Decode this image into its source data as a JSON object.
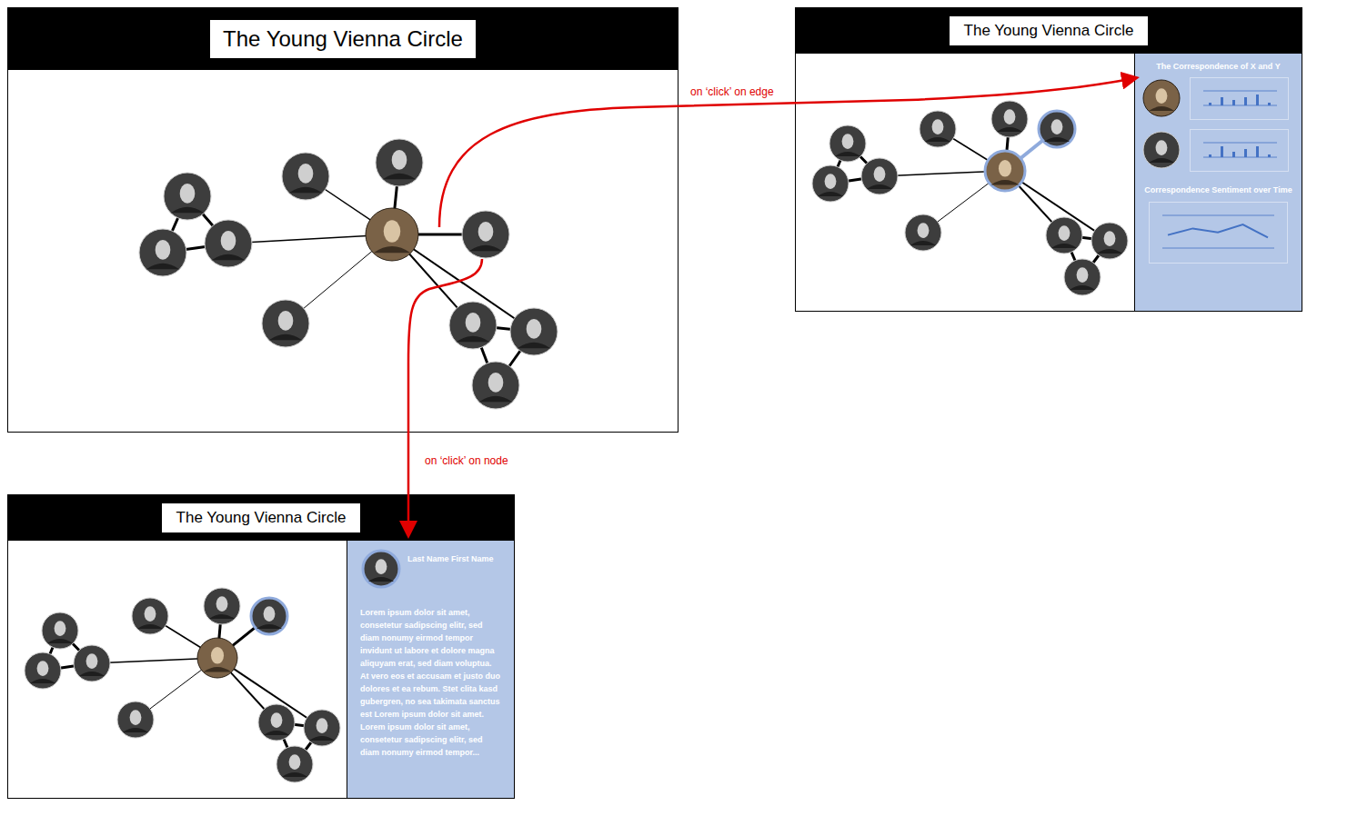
{
  "overview": {
    "title": "The Young Vienna Circle",
    "nodes": [
      {
        "kind": "center",
        "selected": false
      },
      {
        "kind": "person",
        "selected": false
      },
      {
        "kind": "person",
        "selected": false
      },
      {
        "kind": "person",
        "selected": false
      },
      {
        "kind": "person",
        "selected": false
      },
      {
        "kind": "person",
        "selected": false
      },
      {
        "kind": "person",
        "selected": false
      },
      {
        "kind": "person",
        "selected": false
      },
      {
        "kind": "person",
        "selected": false
      },
      {
        "kind": "person",
        "selected": false
      },
      {
        "kind": "person",
        "selected": false
      }
    ],
    "edges": [
      {
        "from": 1,
        "to": 2,
        "weight": 3,
        "selected": false
      },
      {
        "from": 1,
        "to": 3,
        "weight": 3,
        "selected": false
      },
      {
        "from": 2,
        "to": 3,
        "weight": 3,
        "selected": false
      },
      {
        "from": 3,
        "to": 0,
        "weight": 1.5,
        "selected": false
      },
      {
        "from": 4,
        "to": 0,
        "weight": 1.5,
        "selected": false
      },
      {
        "from": 5,
        "to": 0,
        "weight": 3,
        "selected": false
      },
      {
        "from": 6,
        "to": 0,
        "weight": 3,
        "selected": false
      },
      {
        "from": 7,
        "to": 0,
        "weight": 1,
        "selected": false
      },
      {
        "from": 8,
        "to": 0,
        "weight": 2,
        "selected": false
      },
      {
        "from": 9,
        "to": 0,
        "weight": 2,
        "selected": false
      },
      {
        "from": 8,
        "to": 9,
        "weight": 3,
        "selected": false
      },
      {
        "from": 8,
        "to": 10,
        "weight": 3,
        "selected": false
      },
      {
        "from": 9,
        "to": 10,
        "weight": 3,
        "selected": false
      }
    ]
  },
  "edge_view": {
    "title": "The Young Vienna Circle",
    "nodes": [
      {
        "kind": "center",
        "selected": true
      },
      {
        "kind": "person",
        "selected": false
      },
      {
        "kind": "person",
        "selected": false
      },
      {
        "kind": "person",
        "selected": false
      },
      {
        "kind": "person",
        "selected": false
      },
      {
        "kind": "person",
        "selected": false
      },
      {
        "kind": "person",
        "selected": true
      },
      {
        "kind": "person",
        "selected": false
      },
      {
        "kind": "person",
        "selected": false
      },
      {
        "kind": "person",
        "selected": false
      },
      {
        "kind": "person",
        "selected": false
      }
    ],
    "edges": [
      {
        "from": 1,
        "to": 2,
        "weight": 3,
        "selected": false
      },
      {
        "from": 1,
        "to": 3,
        "weight": 3,
        "selected": false
      },
      {
        "from": 2,
        "to": 3,
        "weight": 3,
        "selected": false
      },
      {
        "from": 3,
        "to": 0,
        "weight": 1.5,
        "selected": false
      },
      {
        "from": 4,
        "to": 0,
        "weight": 1.5,
        "selected": false
      },
      {
        "from": 5,
        "to": 0,
        "weight": 3,
        "selected": false
      },
      {
        "from": 6,
        "to": 0,
        "weight": 3,
        "selected": true
      },
      {
        "from": 7,
        "to": 0,
        "weight": 1,
        "selected": false
      },
      {
        "from": 8,
        "to": 0,
        "weight": 2,
        "selected": false
      },
      {
        "from": 9,
        "to": 0,
        "weight": 2,
        "selected": false
      },
      {
        "from": 8,
        "to": 9,
        "weight": 3,
        "selected": false
      },
      {
        "from": 8,
        "to": 10,
        "weight": 3,
        "selected": false
      },
      {
        "from": 9,
        "to": 10,
        "weight": 3,
        "selected": false
      }
    ],
    "panel": {
      "title": "The Correspondence of X and Y",
      "letters": [
        {
          "kind": "center",
          "values": [
            1,
            3,
            2,
            3,
            4,
            1
          ]
        },
        {
          "kind": "person",
          "values": [
            1,
            4,
            2,
            3,
            4,
            1
          ]
        }
      ],
      "chart_title": "Correspondence Sentiment over Time",
      "sentiment": [
        2,
        3,
        2.4,
        3.6,
        1.6
      ]
    }
  },
  "node_view": {
    "title": "The Young Vienna Circle",
    "nodes": [
      {
        "kind": "center",
        "selected": false
      },
      {
        "kind": "person",
        "selected": false
      },
      {
        "kind": "person",
        "selected": false
      },
      {
        "kind": "person",
        "selected": false
      },
      {
        "kind": "person",
        "selected": false
      },
      {
        "kind": "person",
        "selected": false
      },
      {
        "kind": "person",
        "selected": true
      },
      {
        "kind": "person",
        "selected": false
      },
      {
        "kind": "person",
        "selected": false
      },
      {
        "kind": "person",
        "selected": false
      },
      {
        "kind": "person",
        "selected": false
      }
    ],
    "edges": [
      {
        "from": 1,
        "to": 2,
        "weight": 3,
        "selected": false
      },
      {
        "from": 1,
        "to": 3,
        "weight": 3,
        "selected": false
      },
      {
        "from": 2,
        "to": 3,
        "weight": 3,
        "selected": false
      },
      {
        "from": 3,
        "to": 0,
        "weight": 1.5,
        "selected": false
      },
      {
        "from": 4,
        "to": 0,
        "weight": 1.5,
        "selected": false
      },
      {
        "from": 5,
        "to": 0,
        "weight": 3,
        "selected": false
      },
      {
        "from": 6,
        "to": 0,
        "weight": 3,
        "selected": false
      },
      {
        "from": 7,
        "to": 0,
        "weight": 1,
        "selected": false
      },
      {
        "from": 8,
        "to": 0,
        "weight": 2,
        "selected": false
      },
      {
        "from": 9,
        "to": 0,
        "weight": 2,
        "selected": false
      },
      {
        "from": 8,
        "to": 9,
        "weight": 3,
        "selected": false
      },
      {
        "from": 8,
        "to": 10,
        "weight": 3,
        "selected": false
      },
      {
        "from": 9,
        "to": 10,
        "weight": 3,
        "selected": false
      }
    ],
    "panel": {
      "name": "Last Name First Name",
      "kind": "person",
      "bio": "Lorem ipsum dolor sit amet, consetetur sadipscing elitr, sed diam nonumy eirmod tempor invidunt ut labore et dolore magna aliquyam erat, sed diam voluptua. At vero eos et accusam et justo duo dolores et ea rebum. Stet clita kasd gubergren, no sea takimata sanctus est Lorem ipsum dolor sit amet. Lorem ipsum dolor sit amet, consetetur sadipscing elitr, sed diam nonumy eirmod tempor..."
    }
  },
  "annotations": [
    {
      "text": "on ‘click’ on edge"
    },
    {
      "text": "on ‘click’ on node"
    }
  ]
}
